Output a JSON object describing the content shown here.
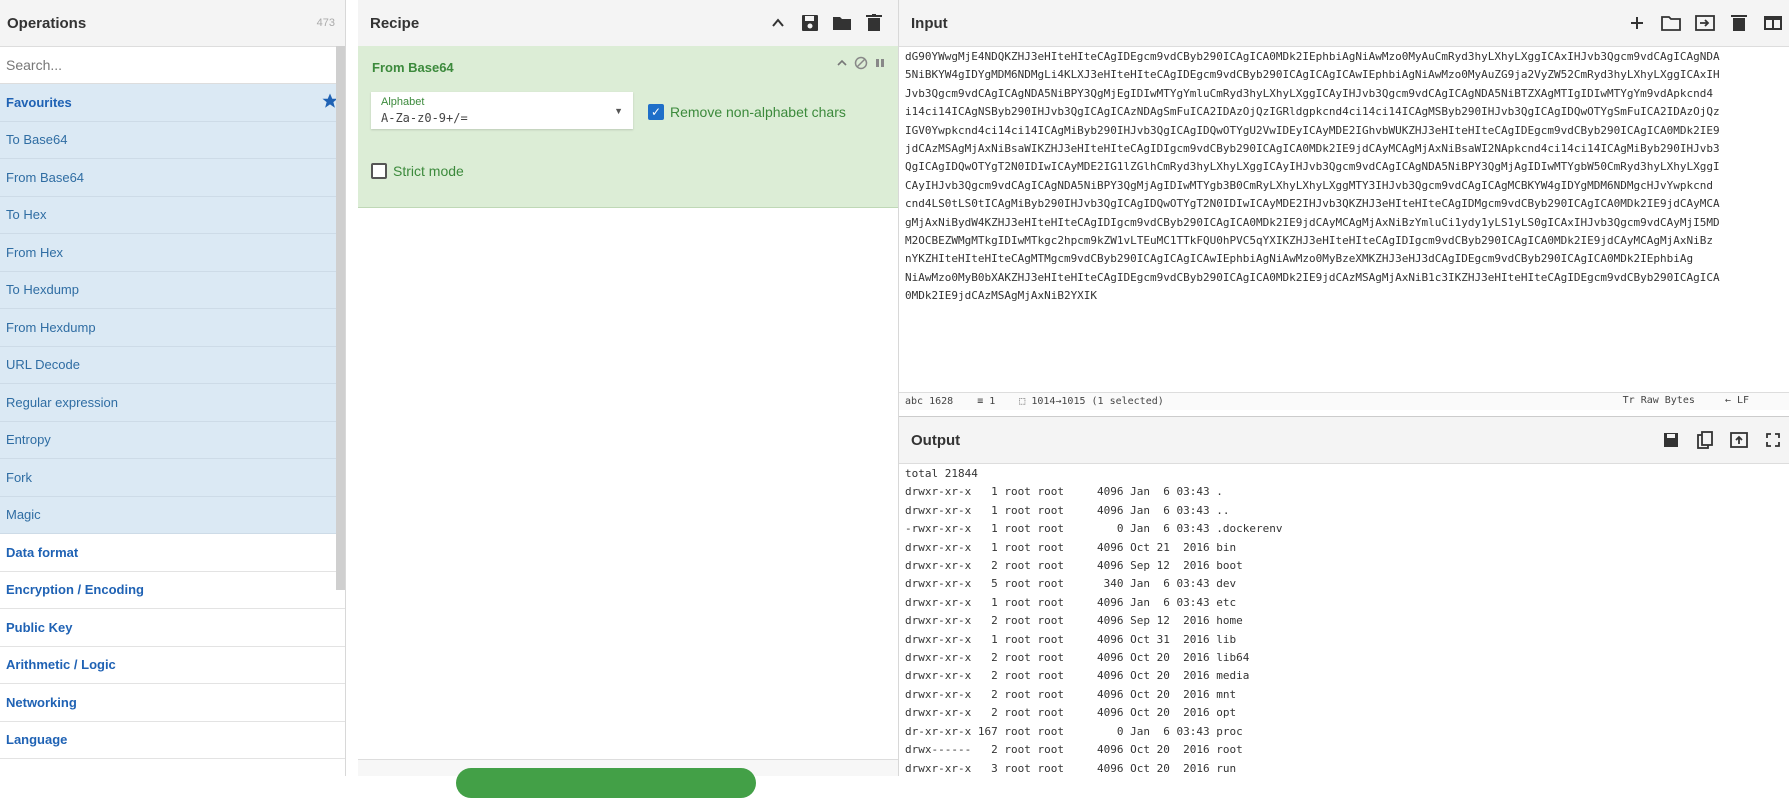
{
  "operations": {
    "title": "Operations",
    "count": "473",
    "search_placeholder": "Search...",
    "favourites_label": "Favourites",
    "items": [
      "To Base64",
      "From Base64",
      "To Hex",
      "From Hex",
      "To Hexdump",
      "From Hexdump",
      "URL Decode",
      "Regular expression",
      "Entropy",
      "Fork",
      "Magic"
    ],
    "categories": [
      "Data format",
      "Encryption / Encoding",
      "Public Key",
      "Arithmetic / Logic",
      "Networking",
      "Language"
    ]
  },
  "recipe": {
    "title": "Recipe",
    "operation": {
      "name": "From Base64",
      "alphabet_label": "Alphabet",
      "alphabet_value": "A-Za-z0-9+/=",
      "remove_nonalpha_label": "Remove non-alphabet chars",
      "strict_mode_label": "Strict mode"
    }
  },
  "input": {
    "title": "Input",
    "lines": [
      "dG90YWwgMjE4NDQKZHJ3eHIteHIteCAgIDEgcm9vdCByb290ICAgICA0MDk2IEphbiAgNiAwMzo0MyAuCmRyd3hyLXhyLXggICAxIHJvb3Qgcm9vdCAgICAgNDA",
      "5NiBKYW4gIDYgMDM6NDMgLi4KLXJ3eHIteHIteCAgIDEgcm9vdCByb290ICAgICAgICAwIEphbiAgNiAwMzo0MyAuZG9ja2VyZW52CmRyd3hyLXhyLXggICAxIH",
      "Jvb3Qgcm9vdCAgICAgNDA5NiBPY3QgMjEgIDIwMTYgYmluCmRyd3hyLXhyLXggICAyIHJvb3Qgcm9vdCAgICAgNDA5NiBTZXAgMTIgIDIwMTYgYm9vdApkcnd4",
      "i14ci14ICAgNSByb290IHJvb3QgICAgICAzNDAgSmFuICA2IDAzOjQzIGRldgpkcnd4ci14ci14ICAgMSByb290IHJvb3QgICAgIDQwOTYgSmFuICA2IDAzOjQz",
      "IGV0Ywpkcnd4ci14ci14ICAgMiByb290IHJvb3QgICAgIDQwOTYgU2VwIDEyICAyMDE2IGhvbWUKZHJ3eHIteHIteCAgIDEgcm9vdCByb290ICAgICA0MDk2IE9",
      "jdCAzMSAgMjAxNiBsaWIKZHJ3eHIteHIteCAgIDIgcm9vdCByb290ICAgICA0MDk2IE9jdCAyMCAgMjAxNiBsaWI2NApkcnd4ci14ci14ICAgMiByb290IHJvb3",
      "QgICAgIDQwOTYgT2N0IDIwICAyMDE2IG1lZGlhCmRyd3hyLXhyLXggICAyIHJvb3Qgcm9vdCAgICAgNDA5NiBPY3QgMjAgIDIwMTYgbW50CmRyd3hyLXhyLXggI",
      "CAyIHJvb3Qgcm9vdCAgICAgNDA5NiBPY3QgMjAgIDIwMTYgb3B0CmRyLXhyLXhyLXggMTY3IHJvb3Qgcm9vdCAgICAgMCBKYW4gIDYgMDM6NDMgcHJvYwpkcnd",
      "cnd4LS0tLS0tICAgMiByb290IHJvb3QgICAgIDQwOTYgT2N0IDIwICAyMDE2IHJvb3QKZHJ3eHIteHIteCAgIDMgcm9vdCByb290ICAgICA0MDk2IE9jdCAyMCA",
      "gMjAxNiBydW4KZHJ3eHIteHIteCAgIDIgcm9vdCByb290ICAgICA0MDk2IE9jdCAyMCAgMjAxNiBzYmluCi1ydy1yLS1yLS0gICAxIHJvb3Qgcm9vdCAyMjI5MD",
      "M2OCBEZWMgMTkgIDIwMTkgc2hpcm9kZW1vLTEuMC1TTkFQU0hPVC5qYXIKZHJ3eHIteHIteCAgIDIgcm9vdCByb290ICAgICA0MDk2IE9jdCAyMCAgMjAxNiBz",
      "nYKZHIteHIteHIteCAgMTMgcm9vdCByb290ICAgICAgICAwIEphbiAgNiAwMzo0MyBzeXMKZHJ3eHJ3dCAgIDEgcm9vdCByb290ICAgICA0MDk2IEphbiAg",
      "NiAwMzo0MyB0bXAKZHJ3eHIteHIteCAgIDEgcm9vdCByb290ICAgICA0MDk2IE9jdCAzMSAgMjAxNiB1c3IKZHJ3eHIteHIteCAgIDEgcm9vdCByb290ICAgICA",
      "0MDk2IE9jdCAzMSAgMjAxNiB2YXIK"
    ],
    "status": {
      "length": "1628",
      "lines": "1",
      "selection": "1014→1015 (1 selected)",
      "raw_bytes": "Raw Bytes",
      "eol": "LF"
    }
  },
  "output": {
    "title": "Output",
    "lines": [
      "total 21844",
      "drwxr-xr-x   1 root root     4096 Jan  6 03:43 .",
      "drwxr-xr-x   1 root root     4096 Jan  6 03:43 ..",
      "-rwxr-xr-x   1 root root        0 Jan  6 03:43 .dockerenv",
      "drwxr-xr-x   1 root root     4096 Oct 21  2016 bin",
      "drwxr-xr-x   2 root root     4096 Sep 12  2016 boot",
      "drwxr-xr-x   5 root root      340 Jan  6 03:43 dev",
      "drwxr-xr-x   1 root root     4096 Jan  6 03:43 etc",
      "drwxr-xr-x   2 root root     4096 Sep 12  2016 home",
      "drwxr-xr-x   1 root root     4096 Oct 31  2016 lib",
      "drwxr-xr-x   2 root root     4096 Oct 20  2016 lib64",
      "drwxr-xr-x   2 root root     4096 Oct 20  2016 media",
      "drwxr-xr-x   2 root root     4096 Oct 20  2016 mnt",
      "drwxr-xr-x   2 root root     4096 Oct 20  2016 opt",
      "dr-xr-xr-x 167 root root        0 Jan  6 03:43 proc",
      "drwx------   2 root root     4096 Oct 20  2016 root",
      "drwxr-xr-x   3 root root     4096 Oct 20  2016 run"
    ]
  },
  "colors": {
    "accent": "#1f62b4",
    "recipe_green": "#dcedd6",
    "favourite_bg": "#dbe9f4"
  }
}
